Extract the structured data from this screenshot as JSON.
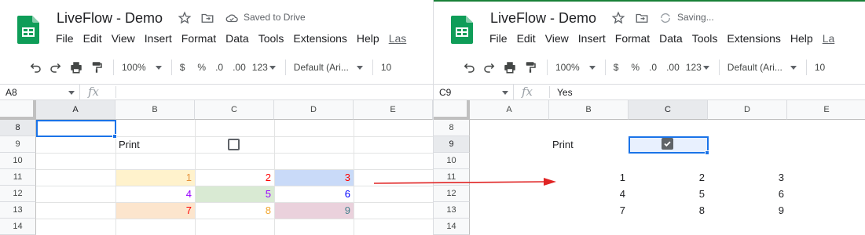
{
  "left": {
    "doc_title": "LiveFlow - Demo",
    "status": "Saved to Drive",
    "menu": [
      "File",
      "Edit",
      "View",
      "Insert",
      "Format",
      "Data",
      "Tools",
      "Extensions",
      "Help"
    ],
    "menu_last": "Las",
    "toolbar": {
      "zoom": "100%",
      "currency": "$",
      "percent": "%",
      "dec_less": ".0",
      "dec_more": ".00",
      "format_more": "123",
      "font": "Default (Ari...",
      "font_size": "10"
    },
    "name_box": "A8",
    "formula_value": "",
    "columns": [
      "A",
      "B",
      "C",
      "D",
      "E"
    ],
    "rows": [
      "8",
      "9",
      "10",
      "11",
      "12",
      "13",
      "14"
    ],
    "print_label": "Print",
    "checkbox_checked": false,
    "values": [
      [
        "1",
        "2",
        "3"
      ],
      [
        "4",
        "5",
        "6"
      ],
      [
        "7",
        "8",
        "9"
      ]
    ]
  },
  "right": {
    "doc_title": "LiveFlow - Demo",
    "status": "Saving...",
    "menu": [
      "File",
      "Edit",
      "View",
      "Insert",
      "Format",
      "Data",
      "Tools",
      "Extensions",
      "Help"
    ],
    "menu_last": "La",
    "toolbar": {
      "zoom": "100%",
      "currency": "$",
      "percent": "%",
      "dec_less": ".0",
      "dec_more": ".00",
      "format_more": "123",
      "font": "Default (Ari...",
      "font_size": "10"
    },
    "name_box": "C9",
    "formula_value": "Yes",
    "columns": [
      "A",
      "B",
      "C",
      "D",
      "E"
    ],
    "rows": [
      "8",
      "9",
      "10",
      "11",
      "12",
      "13",
      "14"
    ],
    "print_label": "Print",
    "checkbox_checked": true,
    "values": [
      [
        "1",
        "2",
        "3"
      ],
      [
        "4",
        "5",
        "6"
      ],
      [
        "7",
        "8",
        "9"
      ]
    ]
  },
  "colors": {
    "sheets_green": "#0f9d58",
    "selection_blue": "#1a73e8",
    "arrow_red": "#e02424",
    "fill_orange_light": "#fff2cc",
    "fill_green_light": "#d9ead3",
    "fill_blue_light": "#c9daf8",
    "fill_peach": "#fce5cd",
    "fill_pink": "#ead1dc",
    "text_orange": "#e69138",
    "text_red": "#ff0000",
    "text_purple": "#9900ff",
    "text_blue": "#0000ff",
    "text_teal": "#45818e"
  }
}
